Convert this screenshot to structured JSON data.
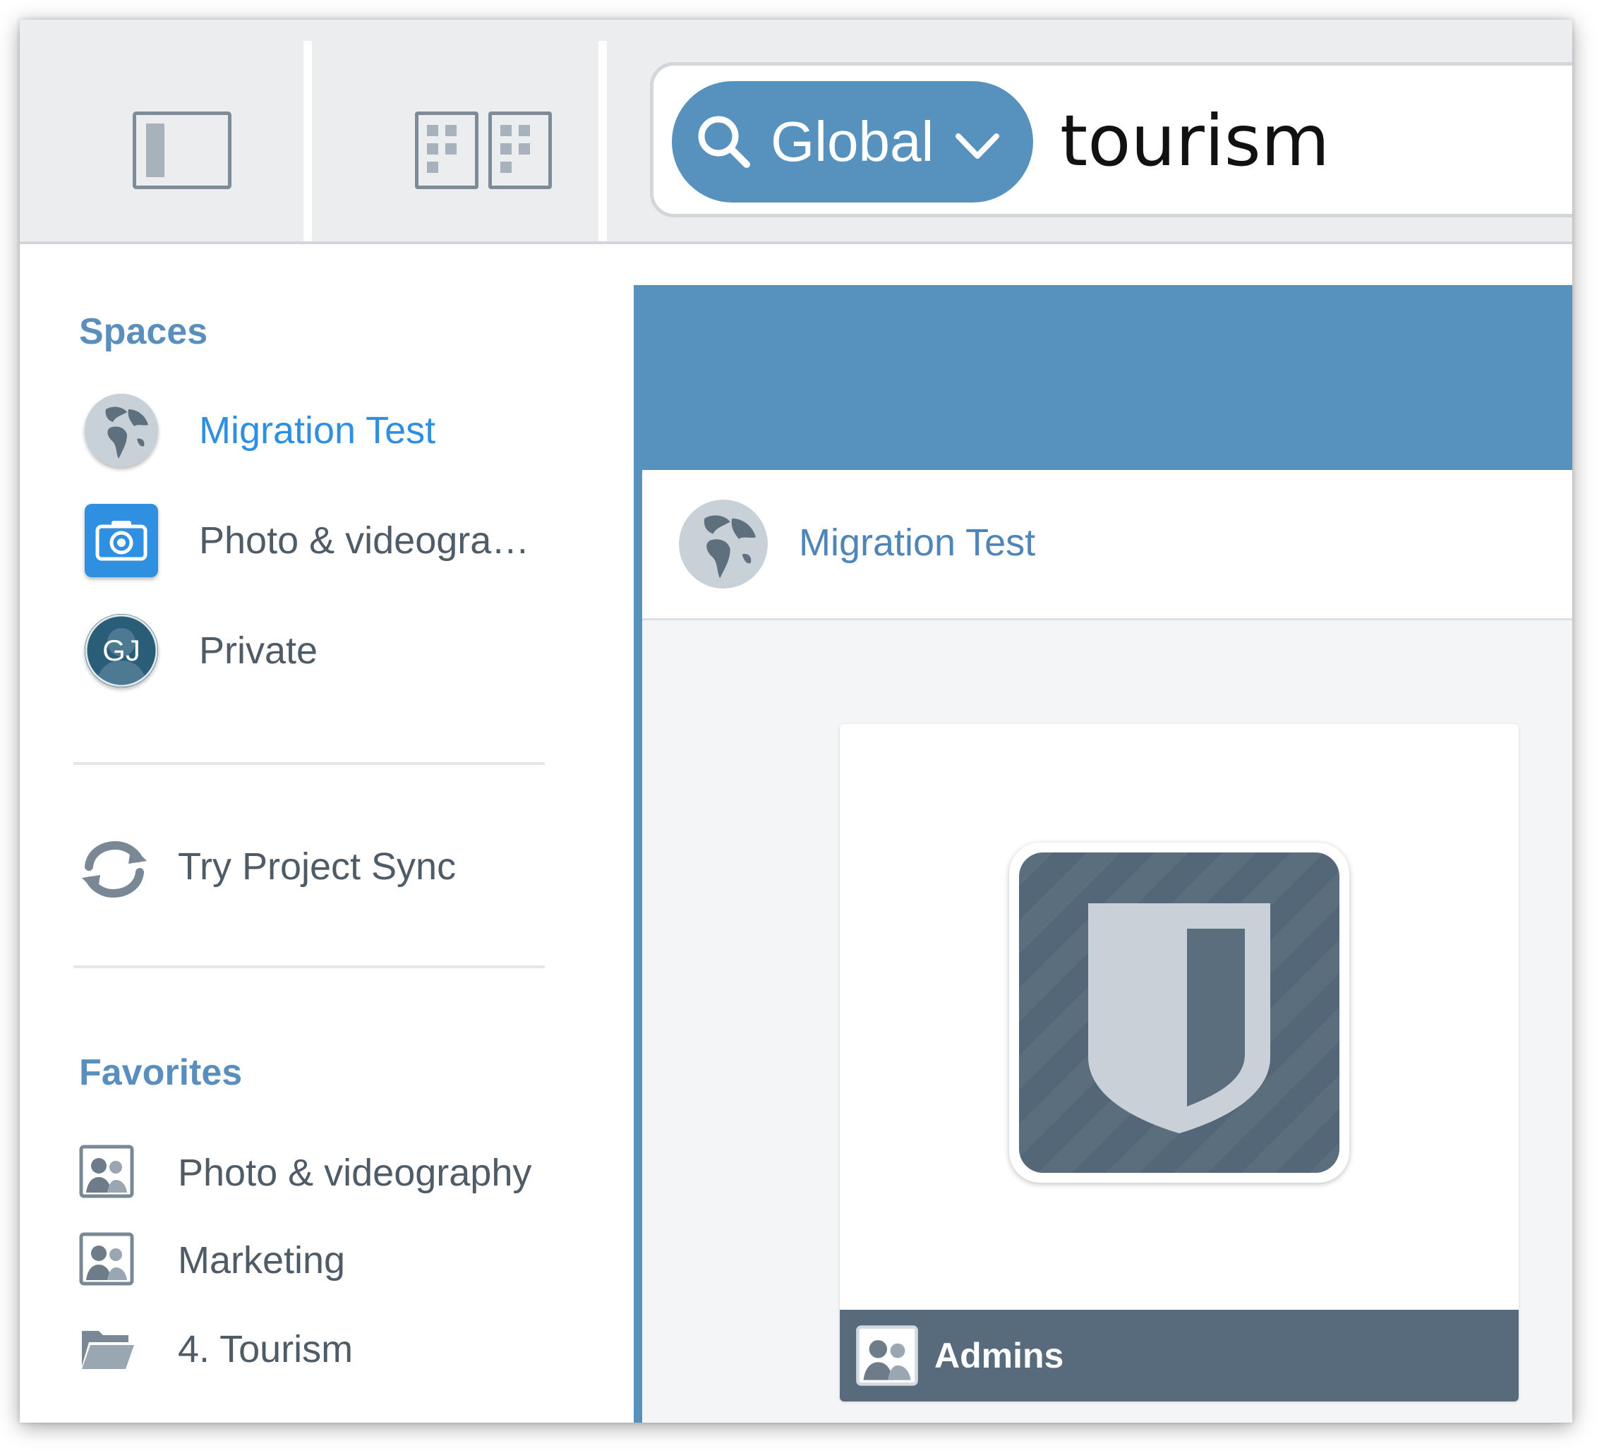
{
  "search": {
    "scope_label": "Global",
    "query": "tourism"
  },
  "sidebar": {
    "spaces_title": "Spaces",
    "spaces": [
      {
        "label": "Migration Test",
        "icon": "globe-icon",
        "active": true
      },
      {
        "label": "Photo & videogra…",
        "icon": "camera-icon",
        "active": false
      },
      {
        "label": "Private",
        "icon": "avatar-initials",
        "initials": "GJ",
        "active": false
      }
    ],
    "project_sync_label": "Try Project Sync",
    "favorites_title": "Favorites",
    "favorites": [
      {
        "label": "Photo & videography",
        "icon": "group-icon"
      },
      {
        "label": "Marketing",
        "icon": "group-icon"
      },
      {
        "label": "4. Tourism",
        "icon": "folder-icon"
      }
    ]
  },
  "main": {
    "space_label": "Migration Test",
    "card": {
      "label": "Admins",
      "icon": "shield-icon"
    }
  },
  "colors": {
    "accent": "#5792be",
    "active_link": "#2f8fe0",
    "card_footer": "#586b7c"
  }
}
